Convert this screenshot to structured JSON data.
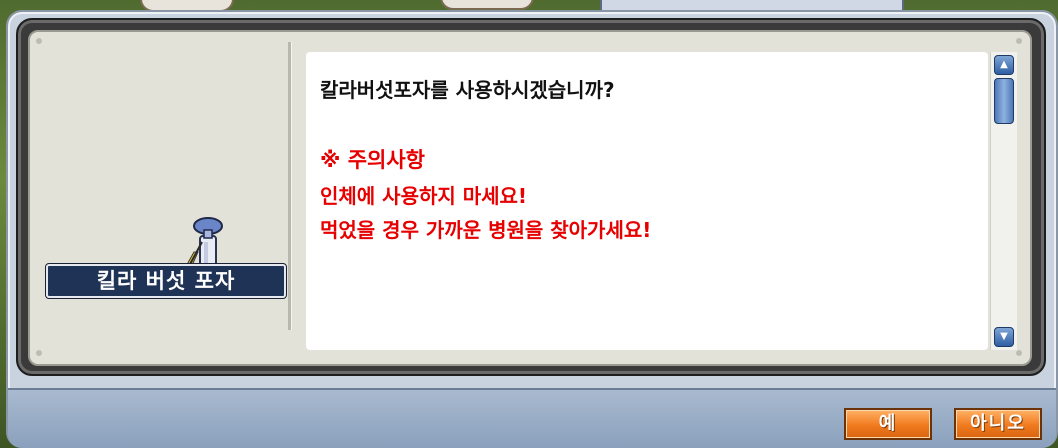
{
  "dialog": {
    "item_name": "킬라 버섯 포자",
    "question": "칼라버섯포자를 사용하시겠습니까?",
    "warning_heading": "※ 주의사항",
    "warning_line1": "인체에 사용하지 마세요!",
    "warning_line2": "먹었을 경우 가까운 병원을 찾아가세요!"
  },
  "buttons": {
    "yes_label": "예",
    "no_label": "아니오"
  },
  "icons": {
    "item": "mushroom-spore-bottle-icon",
    "scroll_up": "arrow-up-icon",
    "scroll_down": "arrow-down-icon"
  },
  "colors": {
    "warning": "#e60000",
    "button": "#f07a1e",
    "name_plate": "#1f3356"
  }
}
